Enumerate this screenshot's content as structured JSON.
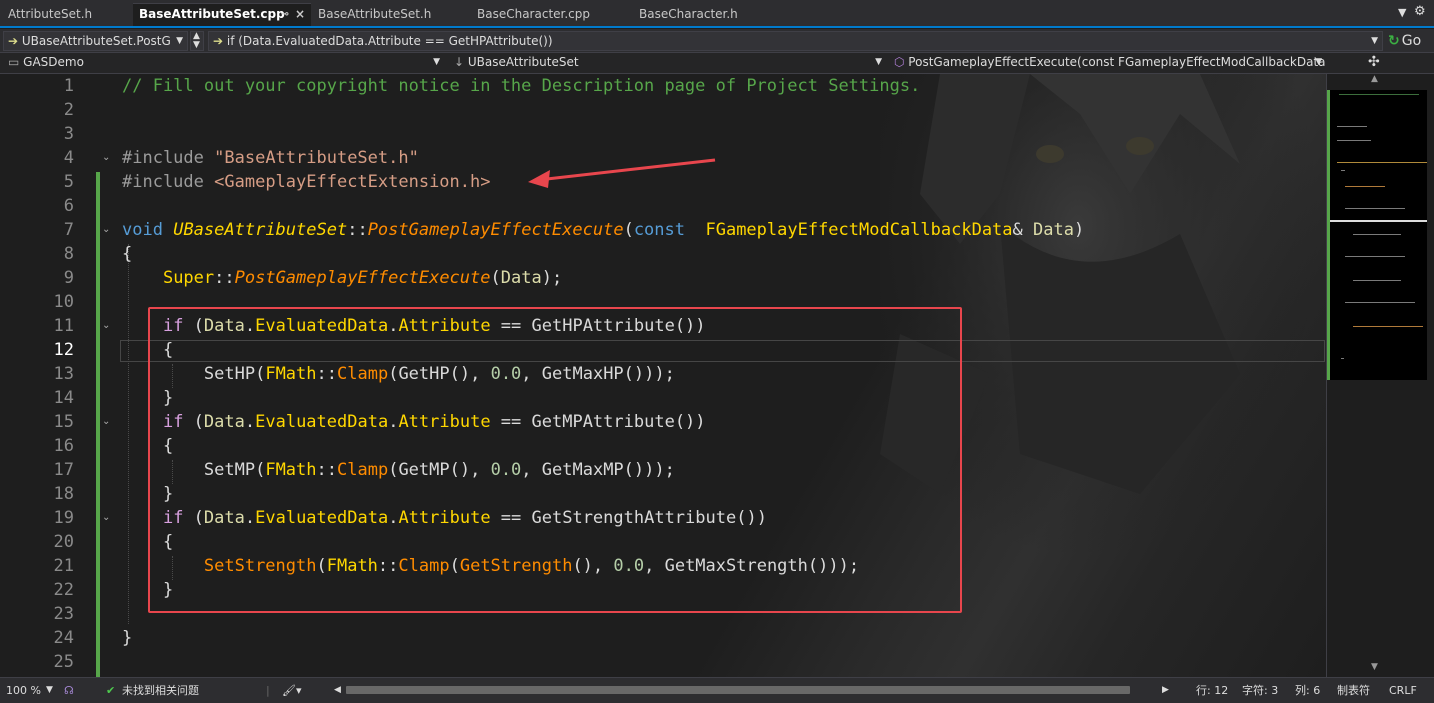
{
  "tabs": [
    {
      "label": "AttributeSet.h",
      "active": false
    },
    {
      "label": "BaseAttributeSet.cpp",
      "active": true
    },
    {
      "label": "BaseAttributeSet.h",
      "active": false
    },
    {
      "label": "BaseCharacter.cpp",
      "active": false
    },
    {
      "label": "BaseCharacter.h",
      "active": false
    }
  ],
  "nav": {
    "member_combo": "UBaseAttributeSet.PostG",
    "scope_combo": "if (Data.EvaluatedData.Attribute == GetHPAttribute())",
    "go_label": "Go",
    "project_combo": "GASDemo",
    "class_combo": "UBaseAttributeSet",
    "function_combo": "PostGameplayEffectExecute(const FGameplayEffectModCallbackData"
  },
  "editor": {
    "current_line": 12,
    "lines": [
      {
        "n": "1",
        "text": "// Fill out your copyright notice in the Description page of Project Settings."
      },
      {
        "n": "2",
        "text": ""
      },
      {
        "n": "3",
        "text": ""
      },
      {
        "n": "4",
        "text": "#include \"BaseAttributeSet.h\""
      },
      {
        "n": "5",
        "text": "#include <GameplayEffectExtension.h>"
      },
      {
        "n": "6",
        "text": ""
      },
      {
        "n": "7",
        "text": "void UBaseAttributeSet::PostGameplayEffectExecute(const  FGameplayEffectModCallbackData& Data)"
      },
      {
        "n": "8",
        "text": "{"
      },
      {
        "n": "9",
        "text": "    Super::PostGameplayEffectExecute(Data);"
      },
      {
        "n": "10",
        "text": ""
      },
      {
        "n": "11",
        "text": "    if (Data.EvaluatedData.Attribute == GetHPAttribute())"
      },
      {
        "n": "12",
        "text": "    {"
      },
      {
        "n": "13",
        "text": "        SetHP(FMath::Clamp(GetHP(), 0.0, GetMaxHP()));"
      },
      {
        "n": "14",
        "text": "    }"
      },
      {
        "n": "15",
        "text": "    if (Data.EvaluatedData.Attribute == GetMPAttribute())"
      },
      {
        "n": "16",
        "text": "    {"
      },
      {
        "n": "17",
        "text": "        SetMP(FMath::Clamp(GetMP(), 0.0, GetMaxMP()));"
      },
      {
        "n": "18",
        "text": "    }"
      },
      {
        "n": "19",
        "text": "    if (Data.EvaluatedData.Attribute == GetStrengthAttribute())"
      },
      {
        "n": "20",
        "text": "    {"
      },
      {
        "n": "21",
        "text": "        SetStrength(FMath::Clamp(GetStrength(), 0.0, GetMaxStrength()));"
      },
      {
        "n": "22",
        "text": "    }"
      },
      {
        "n": "23",
        "text": ""
      },
      {
        "n": "24",
        "text": "}"
      },
      {
        "n": "25",
        "text": ""
      }
    ]
  },
  "status": {
    "zoom": "100 %",
    "issues": "未找到相关问题",
    "line": "行: 12",
    "char": "字符: 3",
    "col": "列: 6",
    "tabs_mode": "制表符",
    "eol": "CRLF"
  },
  "colors": {
    "accent": "#007acc",
    "annotation": "#e8464d",
    "changed_bar": "#57a64a"
  },
  "icons": [
    "tab-pin-icon",
    "tab-close-icon",
    "arrow-right-icon",
    "dropdown-icon",
    "go-icon",
    "split-icon",
    "ok-check-icon",
    "brush-icon"
  ]
}
